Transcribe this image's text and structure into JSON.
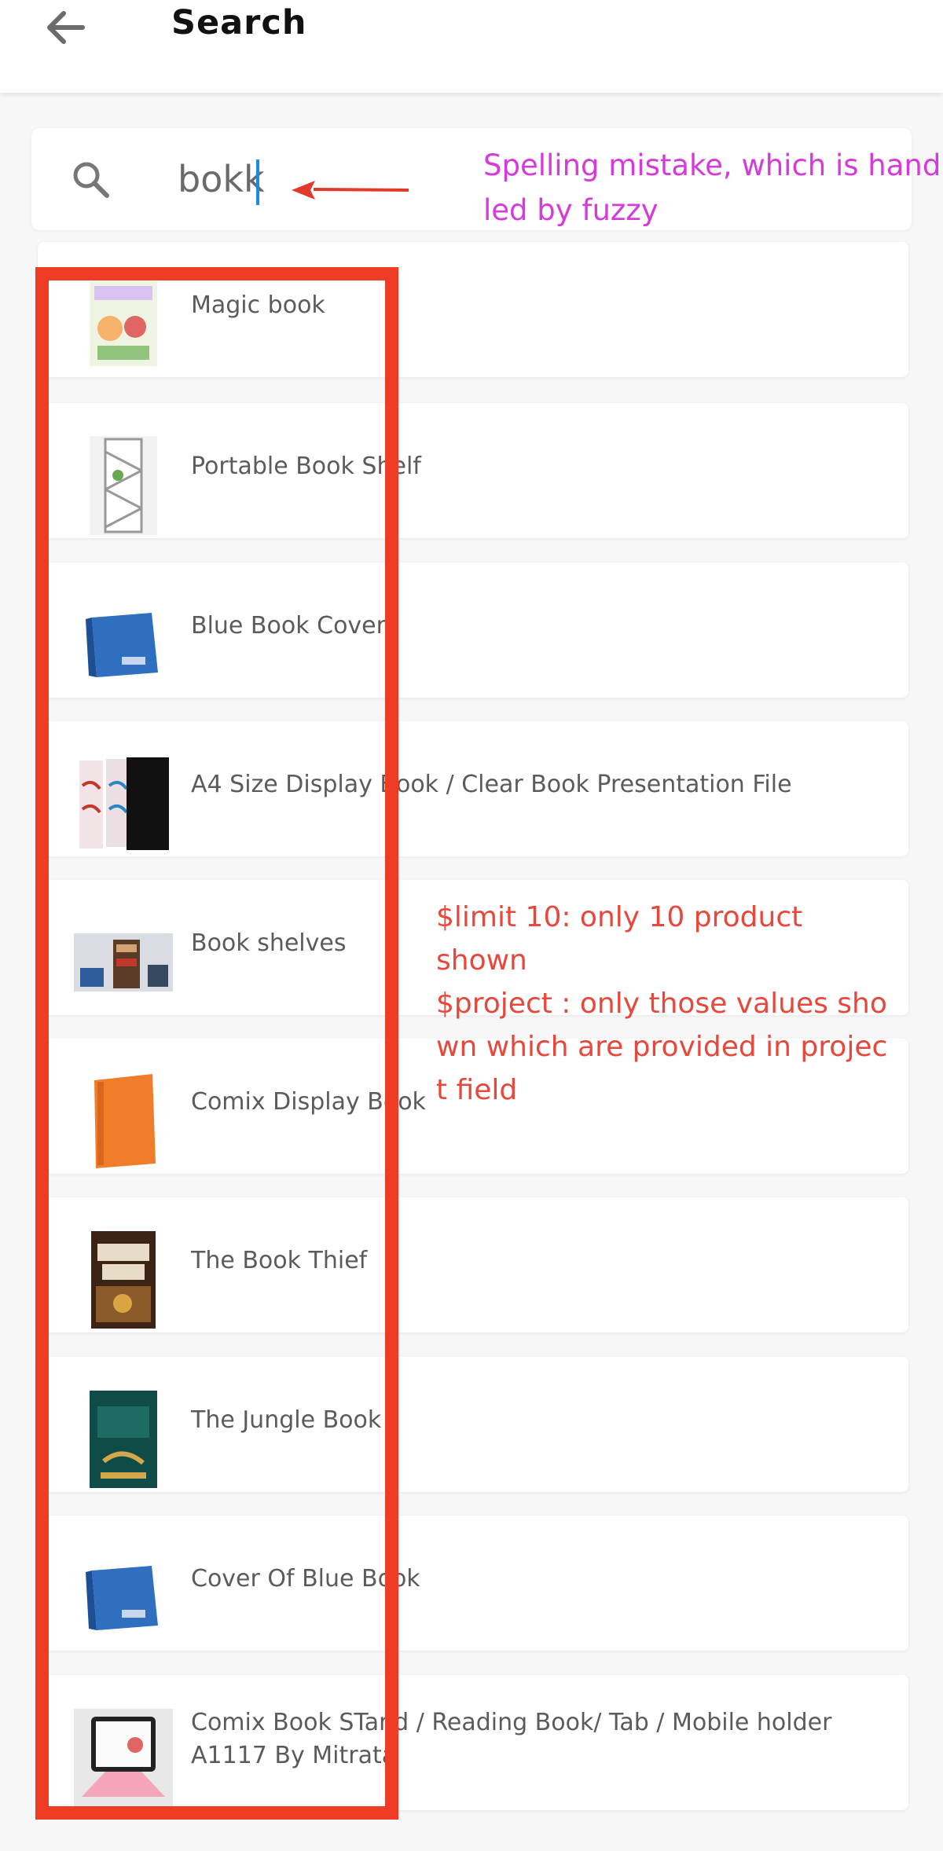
{
  "header": {
    "title": "Search"
  },
  "search": {
    "value": "bokk",
    "placeholder": ""
  },
  "annotations": {
    "spelling": "Spelling mistake, which is hand\nled by fuzzy",
    "limit_project": "$limit 10: only 10 product shown\n$project : only those values sho\nwn which are provided in projec\nt field"
  },
  "colors": {
    "annotation_magenta": "#d63adb",
    "annotation_red": "#e8473c",
    "highlight_box": "#ef3d25",
    "caret": "#1e88e5"
  },
  "results": [
    {
      "label": "Magic book",
      "thumb": "magic-book-thumbnail"
    },
    {
      "label": "Portable Book Shelf",
      "thumb": "bookshelf-thumbnail"
    },
    {
      "label": "Blue Book Cover",
      "thumb": "blue-binder-thumbnail"
    },
    {
      "label": "A4 Size Display Book / Clear Book Presentation File",
      "thumb": "display-file-thumbnail"
    },
    {
      "label": "Book shelves",
      "thumb": "book-shelves-thumbnail"
    },
    {
      "label": "Comix Display Book",
      "thumb": "orange-file-thumbnail"
    },
    {
      "label": "The Book Thief",
      "thumb": "book-thief-cover-thumbnail"
    },
    {
      "label": "The Jungle Book",
      "thumb": "jungle-book-cover-thumbnail"
    },
    {
      "label": "Cover Of Blue Book",
      "thumb": "blue-binder-thumbnail"
    },
    {
      "label": "Comix Book STand / Reading Book/ Tab / Mobile holder A1117 By Mitrata",
      "thumb": "tablet-stand-thumbnail"
    }
  ]
}
